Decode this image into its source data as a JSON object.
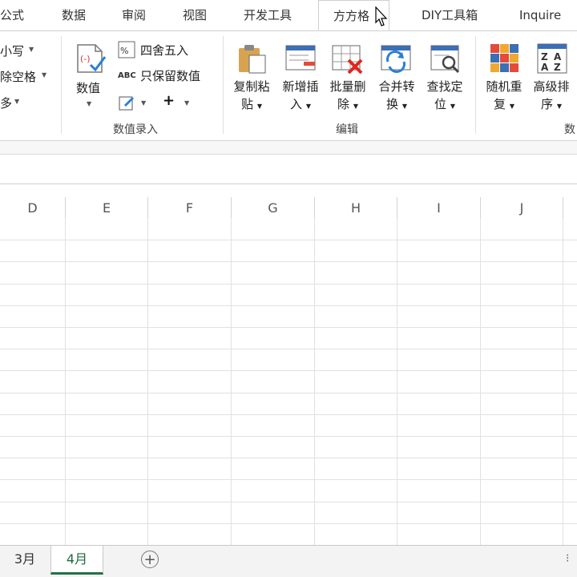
{
  "tabs": {
    "formulas": "公式",
    "data": "数据",
    "review": "审阅",
    "view": "视图",
    "developer": "开发工具",
    "fangfang": "方方格",
    "diy": "DIY工具箱",
    "inquire": "Inquire"
  },
  "ribbon": {
    "text_tools": {
      "lowercase": "小写",
      "remove_spaces": "除空格",
      "more": "多"
    },
    "numeric_entry": {
      "value_label": "数值",
      "round_label": "四舍五入",
      "abc": "ABC",
      "keep_values_label": "只保留数值",
      "plus": "+",
      "group_label": "数值录入"
    },
    "edit": {
      "copy_paste_l1": "复制粘",
      "copy_paste_l2": "贴",
      "insert_l1": "新增插",
      "insert_l2": "入",
      "batch_delete_l1": "批量删",
      "batch_delete_l2": "除",
      "merge_l1": "合并转",
      "merge_l2": "换",
      "find_l1": "查找定",
      "find_l2": "位",
      "group_label": "编辑"
    },
    "data_group": {
      "random_l1": "随机重",
      "random_l2": "复",
      "sort_l1": "高级排",
      "sort_l2": "序",
      "group_label_partial": "数"
    }
  },
  "columns": [
    "D",
    "E",
    "F",
    "G",
    "H",
    "I",
    "J"
  ],
  "sheets": {
    "sheet1": "3月",
    "sheet2": "4月",
    "add": "+"
  },
  "colors": {
    "accent_green": "#217346",
    "grid_line": "#e1e1e1"
  }
}
